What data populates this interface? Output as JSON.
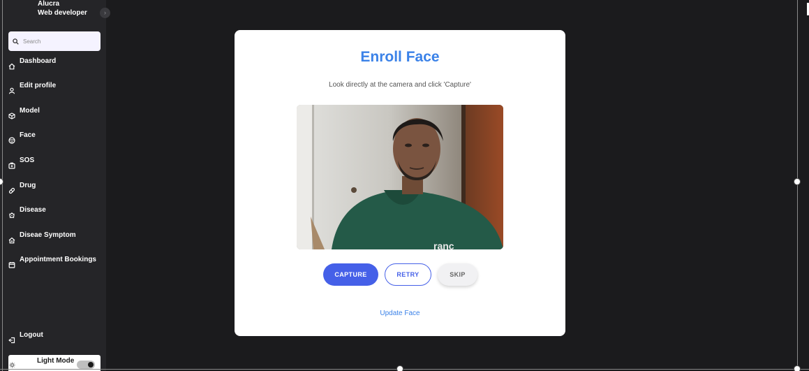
{
  "user": {
    "name": "Alucra",
    "role": "Web developer"
  },
  "search": {
    "placeholder": "Search"
  },
  "nav": {
    "items": [
      {
        "label": "Dashboard",
        "icon": "home-icon"
      },
      {
        "label": "Edit profile",
        "icon": "user-icon"
      },
      {
        "label": "Model",
        "icon": "cube-icon"
      },
      {
        "label": "Face",
        "icon": "face-icon"
      },
      {
        "label": "SOS",
        "icon": "sos-icon"
      },
      {
        "label": "Drug",
        "icon": "pill-icon"
      },
      {
        "label": "Disease",
        "icon": "virus-icon"
      },
      {
        "label": "Diseae Symptom",
        "icon": "symptom-icon"
      },
      {
        "label": "Appointment Bookings",
        "icon": "calendar-icon"
      }
    ],
    "logout": "Logout"
  },
  "mode": {
    "label": "Light Mode",
    "toggle_on": true
  },
  "enroll": {
    "title": "Enroll Face",
    "instruction": "Look directly at the camera and click 'Capture'",
    "capture_label": "CAPTURE",
    "retry_label": "RETRY",
    "skip_label": "SKIP",
    "update_link": "Update Face"
  },
  "colors": {
    "accent": "#3b82e8",
    "primary_button": "#4560e8",
    "sidebar_bg": "#252528",
    "page_bg": "#1b1b1d"
  }
}
